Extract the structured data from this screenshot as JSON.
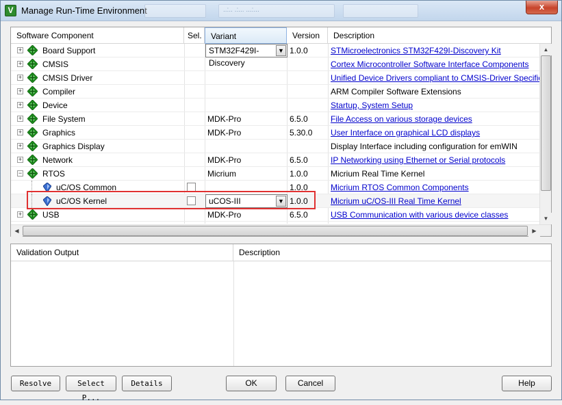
{
  "window": {
    "title": "Manage Run-Time Environment",
    "app_icon": "V",
    "background_hint": "..:.. .:... ...:...",
    "close_label": "x"
  },
  "table": {
    "headers": {
      "component": "Software Component",
      "sel": "Sel.",
      "variant": "Variant",
      "version": "Version",
      "description": "Description"
    },
    "rows": [
      {
        "name": "Board Support",
        "type": "package",
        "expanded": false,
        "variant": "STM32F429I-Discovery",
        "variant_combo": true,
        "version": "1.0.0",
        "description": "STMicroelectronics STM32F429I-Discovery Kit",
        "link": true
      },
      {
        "name": "CMSIS",
        "type": "package",
        "expanded": false,
        "variant": "",
        "version": "",
        "description": "Cortex Microcontroller Software Interface Components",
        "link": true
      },
      {
        "name": "CMSIS Driver",
        "type": "package",
        "expanded": false,
        "variant": "",
        "version": "",
        "description": "Unified Device Drivers compliant to CMSIS-Driver Specifications",
        "link": true
      },
      {
        "name": "Compiler",
        "type": "package",
        "expanded": false,
        "variant": "",
        "version": "",
        "description": "ARM Compiler Software Extensions",
        "link": false
      },
      {
        "name": "Device",
        "type": "package",
        "expanded": false,
        "variant": "",
        "version": "",
        "description": "Startup, System Setup",
        "link": true
      },
      {
        "name": "File System",
        "type": "package",
        "expanded": false,
        "variant": "MDK-Pro",
        "version": "6.5.0",
        "description": "File Access on various storage devices",
        "link": true
      },
      {
        "name": "Graphics",
        "type": "package",
        "expanded": false,
        "variant": "MDK-Pro",
        "version": "5.30.0",
        "description": "User Interface on graphical LCD displays",
        "link": true
      },
      {
        "name": "Graphics Display",
        "type": "package",
        "expanded": false,
        "variant": "",
        "version": "",
        "description": "Display Interface including configuration for emWIN",
        "link": false
      },
      {
        "name": "Network",
        "type": "package",
        "expanded": false,
        "variant": "MDK-Pro",
        "version": "6.5.0",
        "description": "IP Networking using Ethernet or Serial protocols",
        "link": true
      },
      {
        "name": "RTOS",
        "type": "package",
        "expanded": true,
        "variant": "Micrium",
        "version": "1.0.0",
        "description": "Micrium Real Time Kernel",
        "link": false
      },
      {
        "name": "uC/OS Common",
        "type": "leaf",
        "checkbox": true,
        "checked": false,
        "variant": "",
        "version": "1.0.0",
        "description": "Micrium RTOS Common Components",
        "link": true
      },
      {
        "name": "uC/OS Kernel",
        "type": "leaf",
        "checkbox": true,
        "checked": false,
        "variant": "uCOS-III",
        "variant_combo": true,
        "version": "1.0.0",
        "description": "Micrium uC/OS-III Real Time Kernel",
        "link": true,
        "selected": true
      },
      {
        "name": "USB",
        "type": "package",
        "expanded": false,
        "variant": "MDK-Pro",
        "version": "6.5.0",
        "description": "USB Communication with various device classes",
        "link": true
      }
    ]
  },
  "validation": {
    "headers": {
      "output": "Validation Output",
      "description": "Description"
    }
  },
  "buttons": {
    "resolve": "Resolve",
    "select_packs": "Select P...",
    "details": "Details",
    "ok": "OK",
    "cancel": "Cancel",
    "help": "Help"
  },
  "colors": {
    "link": "#0000cc",
    "package_icon": "#1f9a1f",
    "highlight": "#e03030"
  }
}
